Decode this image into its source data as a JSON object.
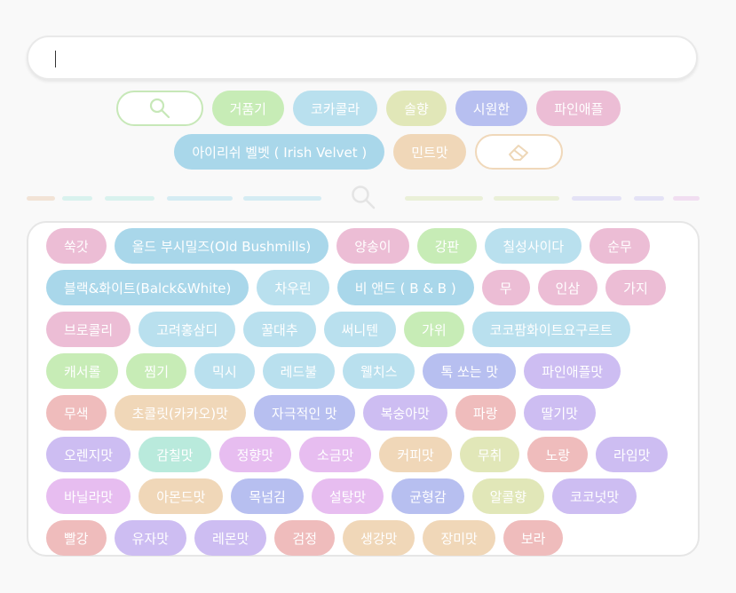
{
  "colors": {
    "green": "#c7ecb6",
    "blue": "#a9d7ea",
    "lightblue": "#b9e0ee",
    "olive": "#e1e7b8",
    "indigo": "#b7bff0",
    "pink": "#ecbdd5",
    "peach": "#f0d7b8",
    "lavender": "#cdbdf2",
    "salmon": "#efbcbc",
    "mint": "#b9eadc",
    "lilac": "#e7bdf0"
  },
  "search_input": {
    "value": ""
  },
  "selected": [
    {
      "label": "거품기",
      "color": "green"
    },
    {
      "label": "코카콜라",
      "color": "lightblue"
    },
    {
      "label": "솔향",
      "color": "olive"
    },
    {
      "label": "시원한",
      "color": "indigo"
    },
    {
      "label": "파인애플",
      "color": "pink"
    },
    {
      "label": "아이리쉬 벨벳 ( Irish Velvet )",
      "color": "blue"
    },
    {
      "label": "민트맛",
      "color": "peach"
    }
  ],
  "icons": {
    "search": "search-icon",
    "eraser": "eraser-icon"
  },
  "tags": [
    {
      "label": "쑥갓",
      "color": "pink"
    },
    {
      "label": "올드 부시밀즈(Old Bushmills)",
      "color": "blue"
    },
    {
      "label": "양송이",
      "color": "pink"
    },
    {
      "label": "강판",
      "color": "green"
    },
    {
      "label": "칠성사이다",
      "color": "lightblue"
    },
    {
      "label": "순무",
      "color": "pink"
    },
    {
      "label": "블랙&화이트(Balck&White)",
      "color": "blue"
    },
    {
      "label": "차우린",
      "color": "lightblue"
    },
    {
      "label": "비 앤드 ( B & B )",
      "color": "blue"
    },
    {
      "label": "무",
      "color": "pink"
    },
    {
      "label": "인삼",
      "color": "pink"
    },
    {
      "label": "가지",
      "color": "pink"
    },
    {
      "label": "브로콜리",
      "color": "pink"
    },
    {
      "label": "고려홍삼디",
      "color": "lightblue"
    },
    {
      "label": "꿀대추",
      "color": "lightblue"
    },
    {
      "label": "써니텐",
      "color": "lightblue"
    },
    {
      "label": "가위",
      "color": "green"
    },
    {
      "label": "코코팜화이트요구르트",
      "color": "lightblue"
    },
    {
      "label": "캐서롤",
      "color": "green"
    },
    {
      "label": "찜기",
      "color": "green"
    },
    {
      "label": "믹시",
      "color": "lightblue"
    },
    {
      "label": "레드불",
      "color": "lightblue"
    },
    {
      "label": "웰치스",
      "color": "lightblue"
    },
    {
      "label": "톡 쏘는 맛",
      "color": "indigo"
    },
    {
      "label": "파인애플맛",
      "color": "lavender"
    },
    {
      "label": "무색",
      "color": "salmon"
    },
    {
      "label": "초콜릿(카카오)맛",
      "color": "peach"
    },
    {
      "label": "자극적인 맛",
      "color": "indigo"
    },
    {
      "label": "복숭아맛",
      "color": "lavender"
    },
    {
      "label": "파랑",
      "color": "salmon"
    },
    {
      "label": "딸기맛",
      "color": "lavender"
    },
    {
      "label": "오렌지맛",
      "color": "lavender"
    },
    {
      "label": "감칠맛",
      "color": "mint"
    },
    {
      "label": "정향맛",
      "color": "lilac"
    },
    {
      "label": "소금맛",
      "color": "lilac"
    },
    {
      "label": "커피맛",
      "color": "peach"
    },
    {
      "label": "무취",
      "color": "olive"
    },
    {
      "label": "노랑",
      "color": "salmon"
    },
    {
      "label": "라임맛",
      "color": "lavender"
    },
    {
      "label": "바닐라맛",
      "color": "lilac"
    },
    {
      "label": "아몬드맛",
      "color": "peach"
    },
    {
      "label": "목넘김",
      "color": "indigo"
    },
    {
      "label": "설탕맛",
      "color": "lilac"
    },
    {
      "label": "균형감",
      "color": "indigo"
    },
    {
      "label": "알콜향",
      "color": "olive"
    },
    {
      "label": "코코넛맛",
      "color": "lavender"
    },
    {
      "label": "빨강",
      "color": "salmon"
    },
    {
      "label": "유자맛",
      "color": "lavender"
    },
    {
      "label": "레몬맛",
      "color": "lavender"
    },
    {
      "label": "검정",
      "color": "salmon"
    },
    {
      "label": "생강맛",
      "color": "peach"
    },
    {
      "label": "장미맛",
      "color": "peach"
    },
    {
      "label": "보라",
      "color": "salmon"
    }
  ]
}
